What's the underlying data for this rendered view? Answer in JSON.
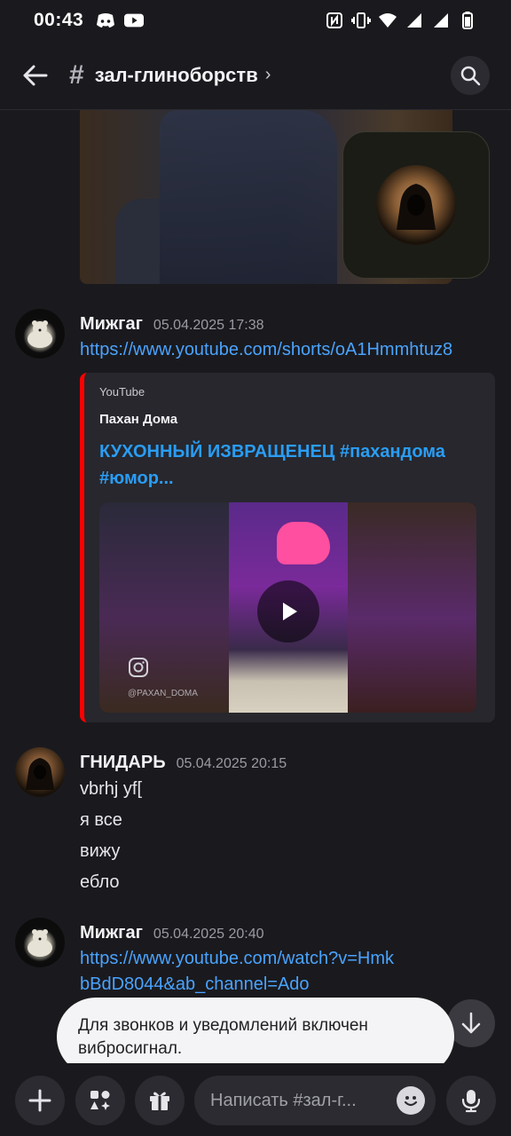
{
  "status_bar": {
    "time": "00:43",
    "icons": [
      "discord-icon",
      "youtube-icon",
      "nfc-icon",
      "vibrate-icon",
      "wifi-icon",
      "signal-icon",
      "signal-icon",
      "battery-icon"
    ]
  },
  "header": {
    "hash": "#",
    "channel": "зал-глиноборств",
    "chevron": "›"
  },
  "messages": [
    {
      "author": "Мижгаг",
      "timestamp": "05.04.2025 17:38",
      "link": "https://www.youtube.com/shorts/oA1Hmmhtuz8",
      "embed": {
        "provider": "YouTube",
        "author": "Пахан Дома",
        "title": "КУХОННЫЙ ИЗВРАЩЕНЕЦ #пахандома #юмор...",
        "watermark": "@PAXAN_DOMA"
      }
    },
    {
      "author": "ГНИДАРЬ",
      "timestamp": "05.04.2025 20:15",
      "lines": [
        "vbrhj yf[",
        "я все",
        "вижу",
        "ебло"
      ]
    },
    {
      "author": "Мижгаг",
      "timestamp": "05.04.2025 20:40",
      "link": "https://www.youtube.com/watch?v=HmkbBdD8044&ab_channel=Ado"
    }
  ],
  "toast": {
    "text": "Для звонков и уведомлений включен вибросигнал."
  },
  "composer": {
    "placeholder": "Написать #зал-г..."
  },
  "colors": {
    "background": "#1a1a1e",
    "link": "#4aa3ff",
    "embed_accent": "#ff0000",
    "embed_title": "#2a9df4"
  }
}
